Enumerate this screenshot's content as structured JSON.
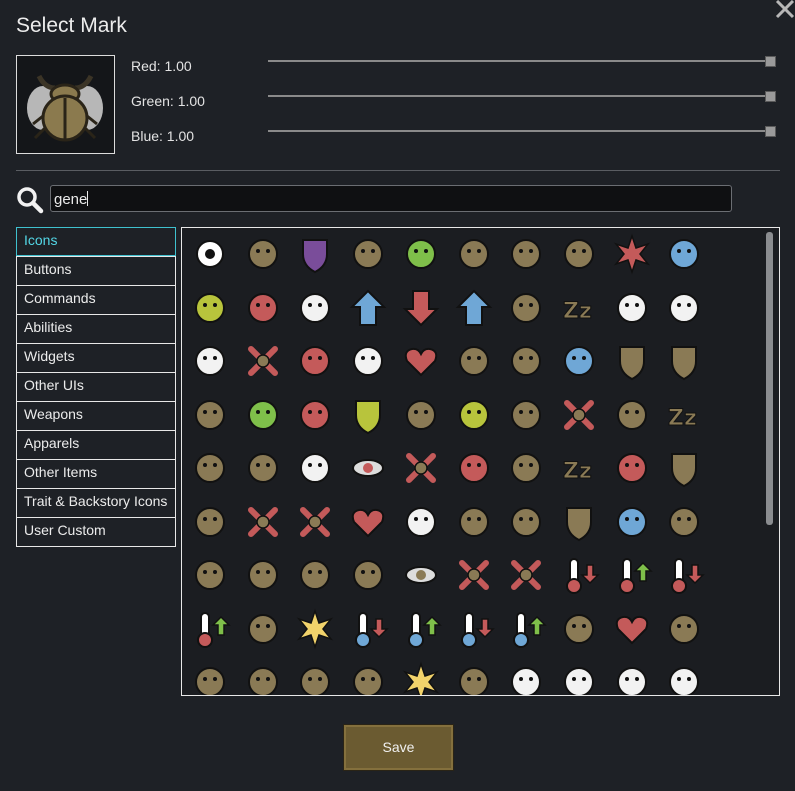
{
  "dialog": {
    "title": "Select Mark",
    "close_icon": "close-x-icon"
  },
  "preview": {
    "icon": "beetle-icon"
  },
  "color": {
    "red": {
      "label": "Red: 1.00",
      "value": 1.0
    },
    "green": {
      "label": "Green: 1.00",
      "value": 1.0
    },
    "blue": {
      "label": "Blue: 1.00",
      "value": 1.0
    }
  },
  "search": {
    "value": "gene",
    "icon": "magnifier-icon"
  },
  "categories": [
    {
      "label": "Icons",
      "active": true
    },
    {
      "label": "Buttons"
    },
    {
      "label": "Commands"
    },
    {
      "label": "Abilities"
    },
    {
      "label": "Widgets"
    },
    {
      "label": "Other UIs"
    },
    {
      "label": "Weapons"
    },
    {
      "label": "Apparels"
    },
    {
      "label": "Other Items"
    },
    {
      "label": "Trait & Backstory Icons"
    },
    {
      "label": "User Custom"
    }
  ],
  "icons": [
    [
      "gear-icon",
      "lungs-icon",
      "shield-purple-icon",
      "planet-icon",
      "splatter-green-icon",
      "stomach-icon",
      "sonic-wave-icon",
      "hourglass-icon",
      "starburst-red-icon",
      "bubbles-blue-icon"
    ],
    [
      "rock-pustules-icon",
      "syringe-red-icon",
      "hand-white-icon",
      "arrow-up-cross-blue-icon",
      "arrow-down-cross-red-icon",
      "arrow-up-plus-blue-icon",
      "running-animal-icon",
      "sleep-zzz-icon",
      "head-mic-icon",
      "head-fur-mic-icon"
    ],
    [
      "fox-head-mic-icon",
      "cross-out-icon",
      "face-red-icon",
      "bearded-face-icon",
      "broken-heart-icon",
      "tusk-icon",
      "hook-icon",
      "arrows-expand-blue-icon",
      "radiation-shield-icon",
      "wolf-shield-icon"
    ],
    [
      "tower-icon",
      "smiley-green-icon",
      "cells-red-icon",
      "shield-yellow-icon",
      "paper-sack-icon",
      "pustules-yellow-icon",
      "stomach-tan-icon",
      "crossed-swords-green-icon",
      "no-entry-icon",
      "sleep-zz-icon"
    ],
    [
      "graduate-down-icon",
      "turtle-icon",
      "body-white-icon",
      "eye-red-icon",
      "skull-cross-blue-icon",
      "dragon-red-icon",
      "rabbit-icon",
      "zz-tan-icon",
      "bone-red-icon",
      "crescent-shield-icon"
    ],
    [
      "radiation-down-icon",
      "crossed-bricks-icon",
      "bow-cross-icon",
      "hearts-red-icon",
      "zombie-head-icon",
      "beetle-small-icon",
      "claws-icon",
      "dice-shield-icon",
      "sad-face-blue-icon",
      "smiley-tan-icon"
    ],
    [
      "armor-icon",
      "dancer-icon",
      "nose-icon",
      "pig-nose-icon",
      "eye-tan-icon",
      "crossed-lizard-icon",
      "crossed-fist-icon",
      "thermometer-down-red-icon",
      "thermometer-up-green-icon",
      "thermometer-down-red2-icon"
    ],
    [
      "thermometer-up-icon",
      "seesaw-icon",
      "sun-burst-icon",
      "thermometer-blue-icon",
      "thermometer-blue-up-icon",
      "thermometer-blue-down-icon",
      "thermometer-blue-up2-icon",
      "leap-arrow-icon",
      "heart-down-icon",
      "knife-icon"
    ],
    [
      "teddy-bear-icon",
      "jaw-icon",
      "lower-jaw-icon",
      "dna-icon",
      "sun-icon",
      "hair-icon",
      "tooth-face-icon",
      "frankenstein-face-icon",
      "long-hair-face-icon",
      "hand-icon"
    ]
  ],
  "buttons": {
    "save": "Save"
  }
}
